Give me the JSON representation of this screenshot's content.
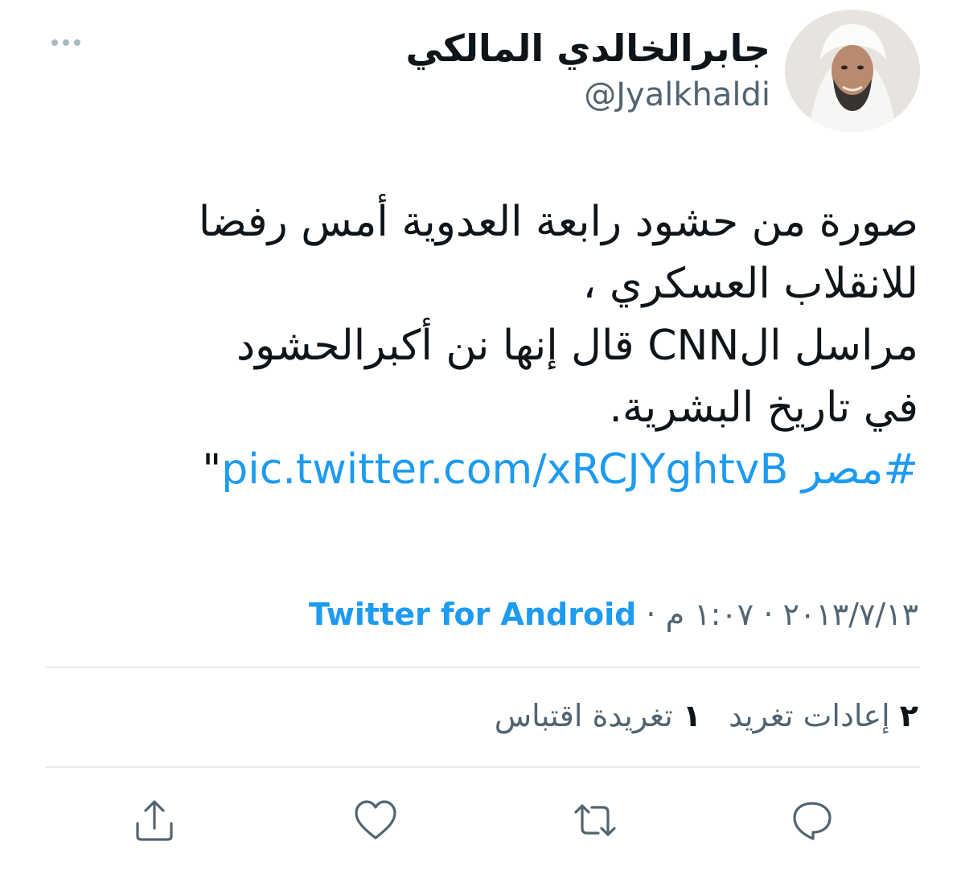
{
  "author": {
    "display_name": "جابرالخالدي المالكي",
    "handle": "@Jyalkhaldi"
  },
  "tweet": {
    "lines": [
      "صورة من حشود رابعة العدوية أمس رفضا",
      "للانقلاب العسكري ،",
      "مراسل الCNN قال إنها نن أكبرالحشود",
      "في تاريخ البشرية."
    ],
    "hashtag": "#مصر",
    "link": "pic.twitter.com/xRCJYghtvB",
    "trailing_quote": "\""
  },
  "meta": {
    "date": "٢٠١٣/٧/١٣",
    "separator": "·",
    "time": "١:٠٧ م",
    "source": "Twitter for Android"
  },
  "stats": {
    "retweets_count": "٢",
    "retweets_label": "إعادات تغريد",
    "quotes_count": "١",
    "quotes_label": "تغريدة اقتباس"
  },
  "colors": {
    "accent": "#1d9bf0",
    "secondary_text": "#536471",
    "icon": "#536471"
  },
  "icons": {
    "more": "more-dots-icon",
    "reply": "reply-bubble-icon",
    "retweet": "retweet-arrows-icon",
    "like": "heart-icon",
    "share": "share-upload-icon"
  }
}
